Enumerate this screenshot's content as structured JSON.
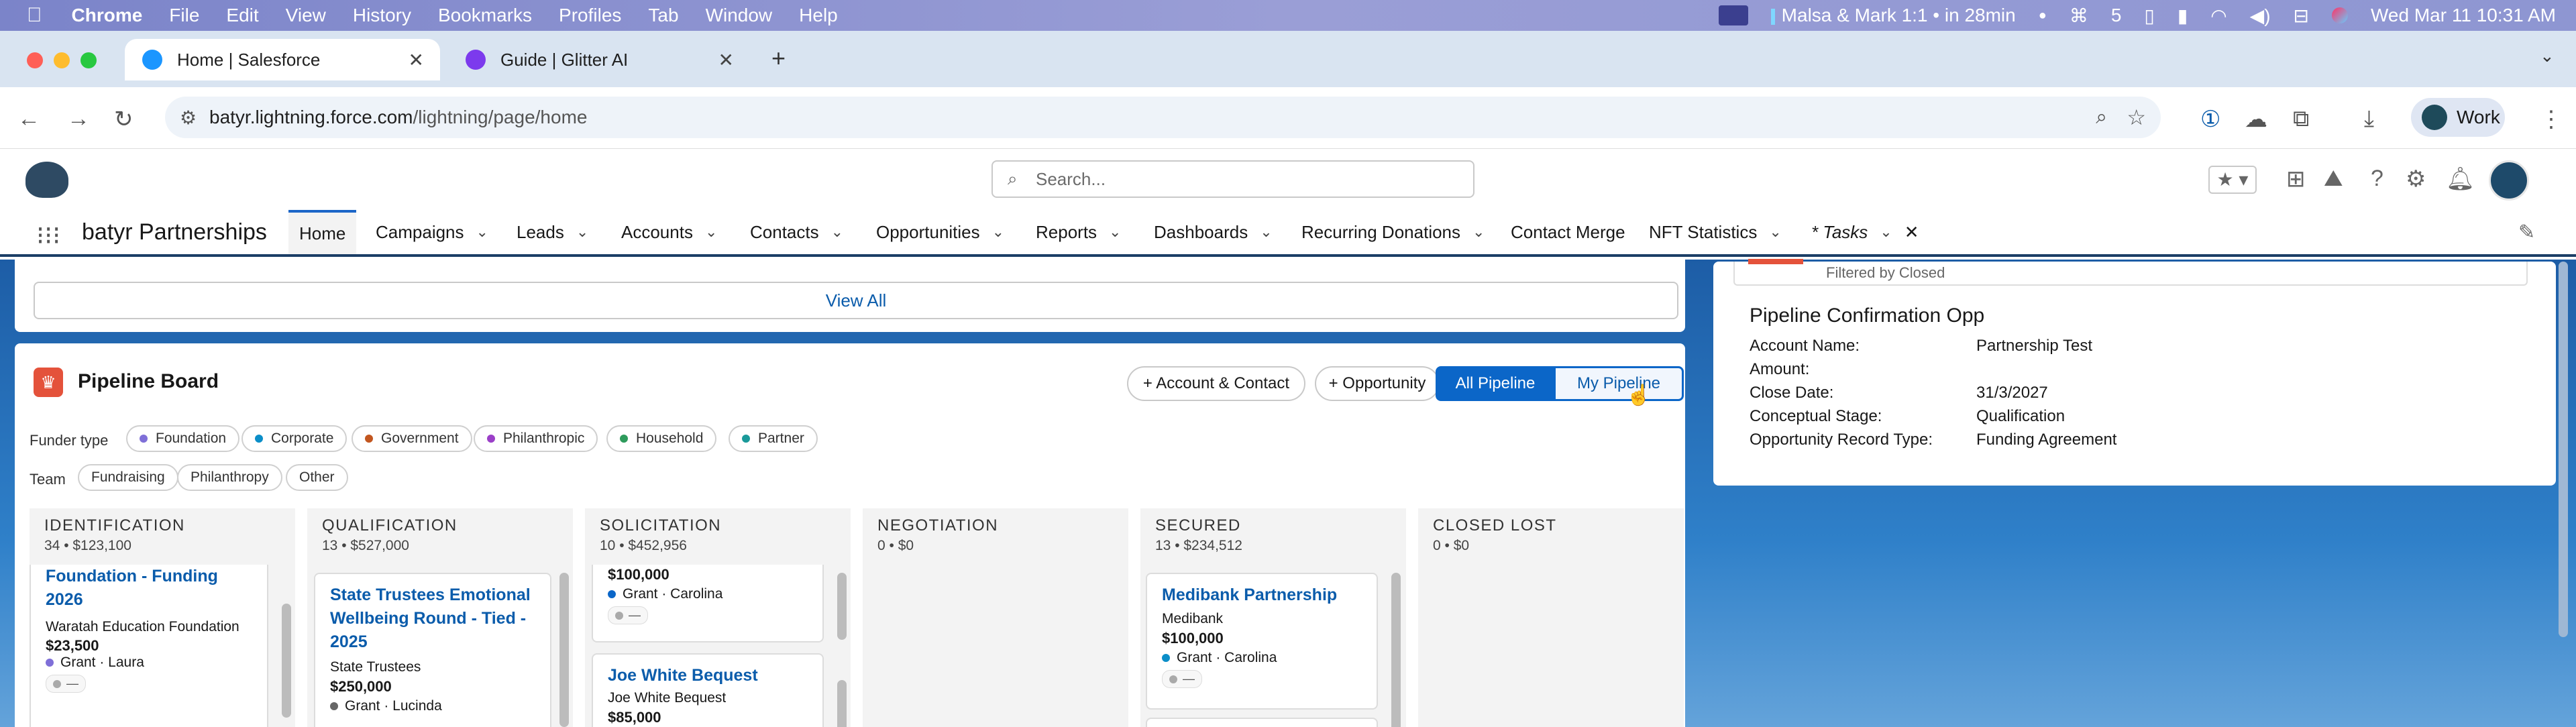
{
  "menubar": {
    "apple": "",
    "items": [
      "Chrome",
      "File",
      "Edit",
      "View",
      "History",
      "Bookmarks",
      "Profiles",
      "Tab",
      "Window",
      "Help"
    ],
    "meeting": "Malsa & Mark 1:1 • in 28min",
    "count": "5",
    "datetime": "Wed Mar 11  10:31 AM"
  },
  "browser": {
    "tabs": [
      {
        "title": "Home | Salesforce",
        "active": true,
        "color": "#1b96ff"
      },
      {
        "title": "Guide | Glitter AI",
        "active": false,
        "color": "#7c3aed"
      }
    ],
    "url_host": "batyr.lightning.force.com",
    "url_path": "/lightning/page/home",
    "profile": "Work"
  },
  "sf": {
    "search_placeholder": "Search...",
    "app_name": "batyr Partnerships",
    "nav": [
      {
        "label": "Home",
        "active": true,
        "chevron": false
      },
      {
        "label": "Campaigns",
        "chevron": true
      },
      {
        "label": "Leads",
        "chevron": true
      },
      {
        "label": "Accounts",
        "chevron": true
      },
      {
        "label": "Contacts",
        "chevron": true
      },
      {
        "label": "Opportunities",
        "chevron": true
      },
      {
        "label": "Reports",
        "chevron": true
      },
      {
        "label": "Dashboards",
        "chevron": true
      },
      {
        "label": "Recurring Donations",
        "chevron": true
      },
      {
        "label": "Contact Merge",
        "chevron": false
      },
      {
        "label": "NFT Statistics",
        "chevron": true
      },
      {
        "label": "* Tasks",
        "chevron": true
      }
    ]
  },
  "home": {
    "view_all": "View All",
    "pipeline": {
      "title": "Pipeline Board",
      "btn_account_contact": "+ Account & Contact",
      "btn_opportunity": "+ Opportunity",
      "btn_all": "All Pipeline",
      "btn_my": "My Pipeline",
      "funder_label": "Funder type",
      "funder_types": [
        {
          "label": "Foundation",
          "color": "#7f6fd8"
        },
        {
          "label": "Corporate",
          "color": "#0b8ec8"
        },
        {
          "label": "Government",
          "color": "#c2561f"
        },
        {
          "label": "Philanthropic",
          "color": "#9b3fc8"
        },
        {
          "label": "Household",
          "color": "#2e9b5c"
        },
        {
          "label": "Partner",
          "color": "#1a9a9a"
        }
      ],
      "team_label": "Team",
      "teams": [
        "Fundraising",
        "Philanthropy",
        "Other"
      ],
      "columns": [
        {
          "name": "IDENTIFICATION",
          "summary": "34 • $123,100"
        },
        {
          "name": "QUALIFICATION",
          "summary": "13 • $527,000"
        },
        {
          "name": "SOLICITATION",
          "summary": "10 • $452,956"
        },
        {
          "name": "NEGOTIATION",
          "summary": "0 • $0"
        },
        {
          "name": "SECURED",
          "summary": "13 • $234,512"
        },
        {
          "name": "CLOSED LOST",
          "summary": "0 • $0"
        }
      ],
      "cards": {
        "c1": {
          "title": "Foundation - Funding 2026",
          "account": "Waratah Education Foundation",
          "amount": "$23,500",
          "meta": "Grant · Laura",
          "dot": "#7f6fd8",
          "pill": "—"
        },
        "c2": {
          "title": "State Trustees Emotional Wellbeing Round - Tied - 2025",
          "account": "State Trustees",
          "amount": "$250,000",
          "meta": "Grant · Lucinda",
          "dot": "#666"
        },
        "c3": {
          "amount": "$100,000",
          "meta": "Grant · Carolina",
          "dot": "#0b66c8",
          "pill": "—"
        },
        "c4": {
          "title": "Joe White Bequest",
          "account": "Joe White Bequest",
          "amount": "$85,000"
        },
        "c5": {
          "title": "Medibank Partnership",
          "account": "Medibank",
          "amount": "$100,000",
          "meta": "Grant · Carolina",
          "dot": "#0b8ec8",
          "pill": "—"
        }
      }
    },
    "right": {
      "filter_text": "Filtered by Closed",
      "title": "Pipeline Confirmation Opp",
      "fields": [
        {
          "label": "Account Name:",
          "value": "Partnership Test"
        },
        {
          "label": "Amount:",
          "value": ""
        },
        {
          "label": "Close Date:",
          "value": "31/3/2027"
        },
        {
          "label": "Conceptual Stage:",
          "value": "Qualification"
        },
        {
          "label": "Opportunity Record Type:",
          "value": "Funding Agreement"
        }
      ]
    }
  }
}
